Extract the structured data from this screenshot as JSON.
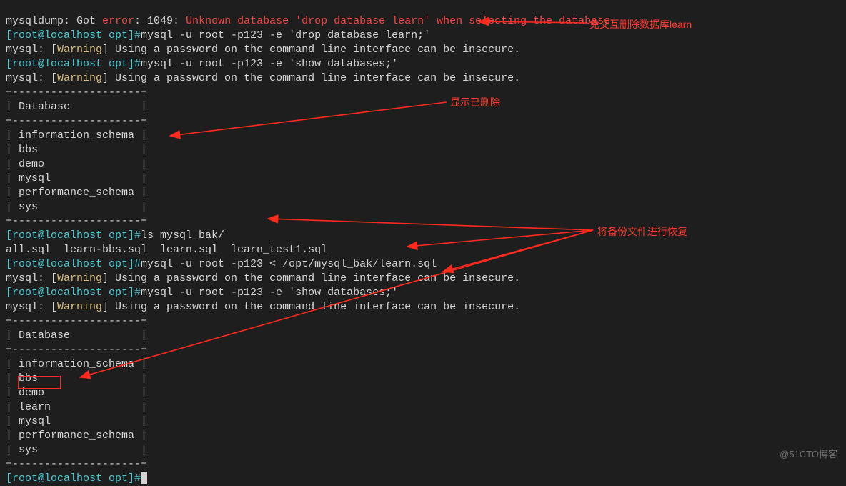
{
  "lines": {
    "l0a": "mysqldump: Got ",
    "l0b": "error",
    "l0c": ": 1049: ",
    "l0d": "Unknown database 'drop database learn' when selecting the database",
    "p1a": "[root@localhost opt]#",
    "p1b": "mysql -u root -p123 -e 'drop database learn;'",
    "w1a": "mysql: [",
    "w1b": "Warning",
    "w1c": "] Using a password on the command line interface can be insecure.",
    "p2b": "mysql -u root -p123 -e 'show databases;'",
    "sep": "+--------------------+",
    "dbh": "| Database           |",
    "r1": "| information_schema |",
    "r2": "| bbs                |",
    "r3": "| demo               |",
    "r4": "| mysql              |",
    "r5": "| performance_schema |",
    "r6": "| sys                |",
    "p3b": "ls mysql_bak/",
    "ls": "all.sql  learn-bbs.sql  learn.sql  learn_test1.sql",
    "p4b": "mysql -u root -p123 < /opt/mysql_bak/learn.sql",
    "p5b": "mysql -u root -p123 -e 'show databases;'",
    "r2_1": "| information_schema |",
    "r2_2": "| bbs                |",
    "r2_3": "| demo               |",
    "r2_4": "| learn              |",
    "r2_5": "| mysql              |",
    "r2_6": "| performance_schema |",
    "r2_7": "| sys                |"
  },
  "annotations": {
    "a1": "免交互删除数据库learn",
    "a2": "显示已删除",
    "a3": "将备份文件进行恢复"
  },
  "watermark": "@51CTO博客",
  "colors": {
    "arrow": "#ff2a1e"
  }
}
